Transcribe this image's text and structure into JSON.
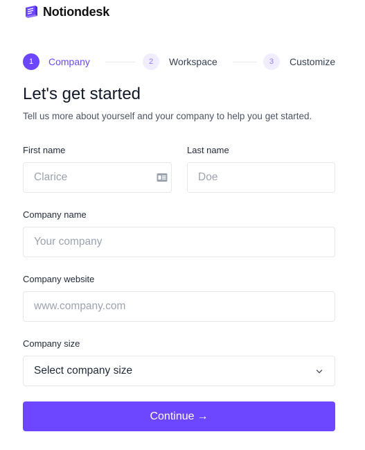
{
  "brand": {
    "name": "Notiondesk",
    "icon": "book-logo-icon",
    "color": "#6c47ff"
  },
  "stepper": {
    "steps": [
      {
        "number": "1",
        "label": "Company",
        "state": "active"
      },
      {
        "number": "2",
        "label": "Workspace",
        "state": "inactive"
      },
      {
        "number": "3",
        "label": "Customize",
        "state": "inactive"
      }
    ]
  },
  "header": {
    "title": "Let's get started",
    "subtitle": "Tell us more about yourself and your company to help you get started."
  },
  "form": {
    "first_name": {
      "label": "First name",
      "placeholder": "Clarice",
      "value": "",
      "icon": "contact-card-icon"
    },
    "last_name": {
      "label": "Last name",
      "placeholder": "Doe",
      "value": ""
    },
    "company_name": {
      "label": "Company name",
      "placeholder": "Your company",
      "value": ""
    },
    "company_website": {
      "label": "Company website",
      "placeholder": "www.company.com",
      "value": ""
    },
    "company_size": {
      "label": "Company size",
      "selected": "Select company size",
      "icon": "chevron-down-icon"
    }
  },
  "actions": {
    "continue_label": "Continue",
    "continue_arrow": "→"
  },
  "colors": {
    "accent": "#6c47ff",
    "accent_light": "#f1edff",
    "border": "#e5e7eb",
    "placeholder": "#9ca3af"
  }
}
